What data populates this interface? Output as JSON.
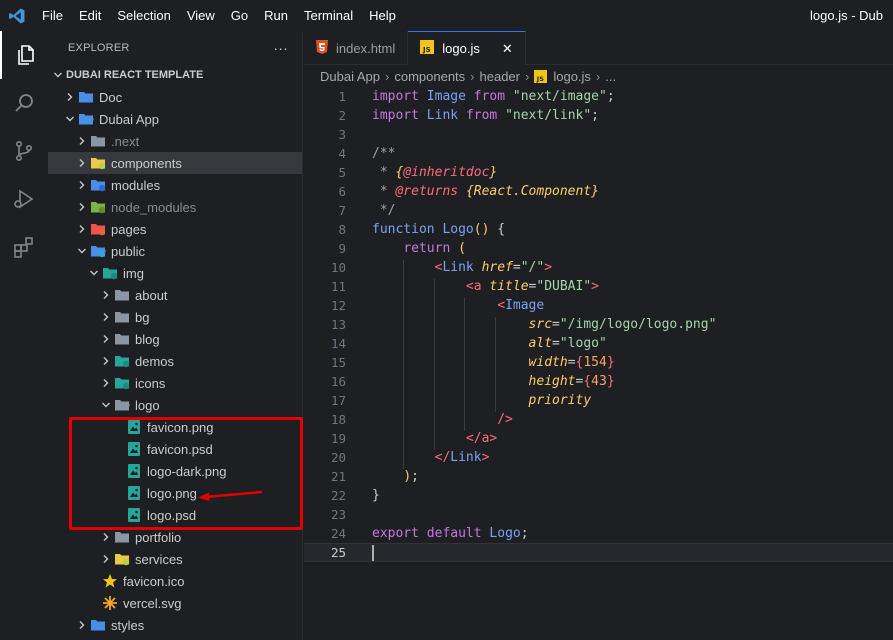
{
  "menu": {
    "items": [
      "File",
      "Edit",
      "Selection",
      "View",
      "Go",
      "Run",
      "Terminal",
      "Help"
    ],
    "window_title": "logo.js - Dub"
  },
  "activity": [
    "explorer-icon",
    "search-icon",
    "source-control-icon",
    "run-debug-icon",
    "extensions-icon"
  ],
  "sidebar": {
    "title": "EXPLORER",
    "more": "···",
    "root": "DUBAI REACT TEMPLATE",
    "items": [
      {
        "label": "Doc",
        "depth": 1,
        "chev": "right",
        "icon": "folder-blue"
      },
      {
        "label": "Dubai App",
        "depth": 1,
        "chev": "down",
        "icon": "folder-blue-open"
      },
      {
        "label": ".next",
        "depth": 2,
        "chev": "right",
        "icon": "folder-gray",
        "dim": true
      },
      {
        "label": "components",
        "depth": 2,
        "chev": "right",
        "icon": "folder-yellow",
        "selected": true
      },
      {
        "label": "modules",
        "depth": 2,
        "chev": "right",
        "icon": "folder-blue-gear"
      },
      {
        "label": "node_modules",
        "depth": 2,
        "chev": "right",
        "icon": "folder-green",
        "dim": true
      },
      {
        "label": "pages",
        "depth": 2,
        "chev": "right",
        "icon": "folder-red"
      },
      {
        "label": "public",
        "depth": 2,
        "chev": "down",
        "icon": "folder-blue-globe"
      },
      {
        "label": "img",
        "depth": 3,
        "chev": "down",
        "icon": "folder-teal"
      },
      {
        "label": "about",
        "depth": 4,
        "chev": "right",
        "icon": "folder-gray"
      },
      {
        "label": "bg",
        "depth": 4,
        "chev": "right",
        "icon": "folder-gray"
      },
      {
        "label": "blog",
        "depth": 4,
        "chev": "right",
        "icon": "folder-gray"
      },
      {
        "label": "demos",
        "depth": 4,
        "chev": "right",
        "icon": "folder-teal"
      },
      {
        "label": "icons",
        "depth": 4,
        "chev": "right",
        "icon": "folder-teal"
      },
      {
        "label": "logo",
        "depth": 4,
        "chev": "down",
        "icon": "folder-gray-open"
      },
      {
        "label": "favicon.png",
        "depth": 5,
        "chev": "",
        "icon": "image"
      },
      {
        "label": "favicon.psd",
        "depth": 5,
        "chev": "",
        "icon": "image"
      },
      {
        "label": "logo-dark.png",
        "depth": 5,
        "chev": "",
        "icon": "image"
      },
      {
        "label": "logo.png",
        "depth": 5,
        "chev": "",
        "icon": "image"
      },
      {
        "label": "logo.psd",
        "depth": 5,
        "chev": "",
        "icon": "image"
      },
      {
        "label": "portfolio",
        "depth": 4,
        "chev": "right",
        "icon": "folder-gray"
      },
      {
        "label": "services",
        "depth": 4,
        "chev": "right",
        "icon": "folder-yellow"
      },
      {
        "label": "favicon.ico",
        "depth": 3,
        "chev": "",
        "icon": "star"
      },
      {
        "label": "vercel.svg",
        "depth": 3,
        "chev": "",
        "icon": "svg"
      },
      {
        "label": "styles",
        "depth": 2,
        "chev": "right",
        "icon": "folder-blue"
      }
    ]
  },
  "tabs": [
    {
      "label": "index.html",
      "icon": "html-icon",
      "active": false
    },
    {
      "label": "logo.js",
      "icon": "js-icon",
      "active": true,
      "close": "✕"
    }
  ],
  "breadcrumb": [
    "Dubai App",
    "components",
    "header",
    "logo.js",
    "..."
  ],
  "code": {
    "current_line": 25,
    "lines": [
      "import Image from \"next/image\";",
      "import Link from \"next/link\";",
      "",
      "/**",
      " * {@inheritdoc}",
      " * @returns {React.Component}",
      " */",
      "function Logo() {",
      "    return (",
      "        <Link href=\"/\">",
      "            <a title=\"DUBAI\">",
      "                <Image",
      "                    src=\"/img/logo/logo.png\"",
      "                    alt=\"logo\"",
      "                    width={154}",
      "                    height={43}",
      "                    priority",
      "                />",
      "            </a>",
      "        </Link>",
      "    );",
      "}",
      "",
      "export default Logo;",
      ""
    ]
  }
}
